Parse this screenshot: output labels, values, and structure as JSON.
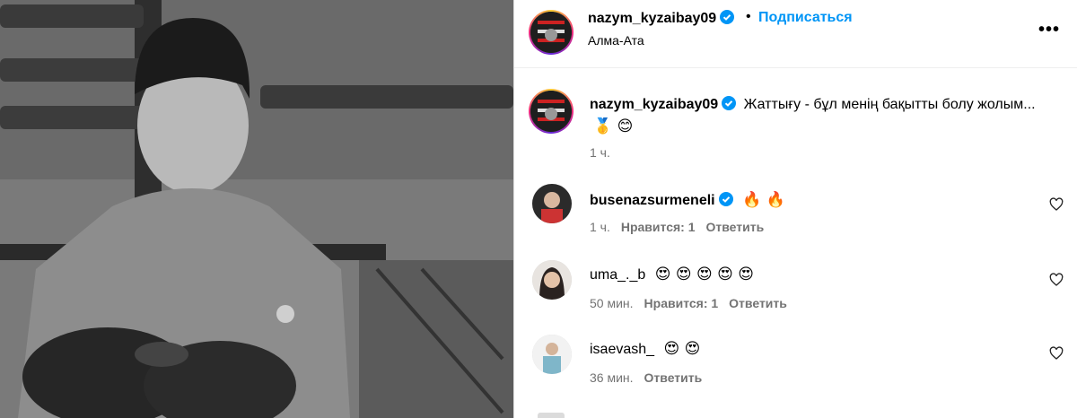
{
  "post": {
    "author": "nazym_kyzaibay09",
    "follow_label": "Подписаться",
    "separator": "•",
    "location": "Алма-Ата",
    "more_label": "•••",
    "caption_text": "Жаттығу - бұл менің бақытты болу жолым...",
    "caption_emoji": "🥇 😊",
    "caption_time": "1 ч."
  },
  "comments": [
    {
      "username": "busenazsurmeneli",
      "text": "🔥 🔥",
      "time": "1 ч.",
      "likes": "Нравится: 1",
      "reply": "Ответить"
    },
    {
      "username": "uma_._b",
      "text": "😍 😍 😍 😍 😍",
      "time": "50 мин.",
      "likes": "Нравится: 1",
      "reply": "Ответить"
    },
    {
      "username": "isaevash_",
      "text": "😍 😍",
      "time": "36 мин.",
      "likes": "",
      "reply": "Ответить"
    }
  ],
  "icons": {
    "verified": "verified-badge-icon",
    "like": "heart-outline-icon",
    "more": "more-options-icon"
  },
  "colors": {
    "link": "#0095f6",
    "meta": "#737373",
    "verified": "#0095f6"
  }
}
